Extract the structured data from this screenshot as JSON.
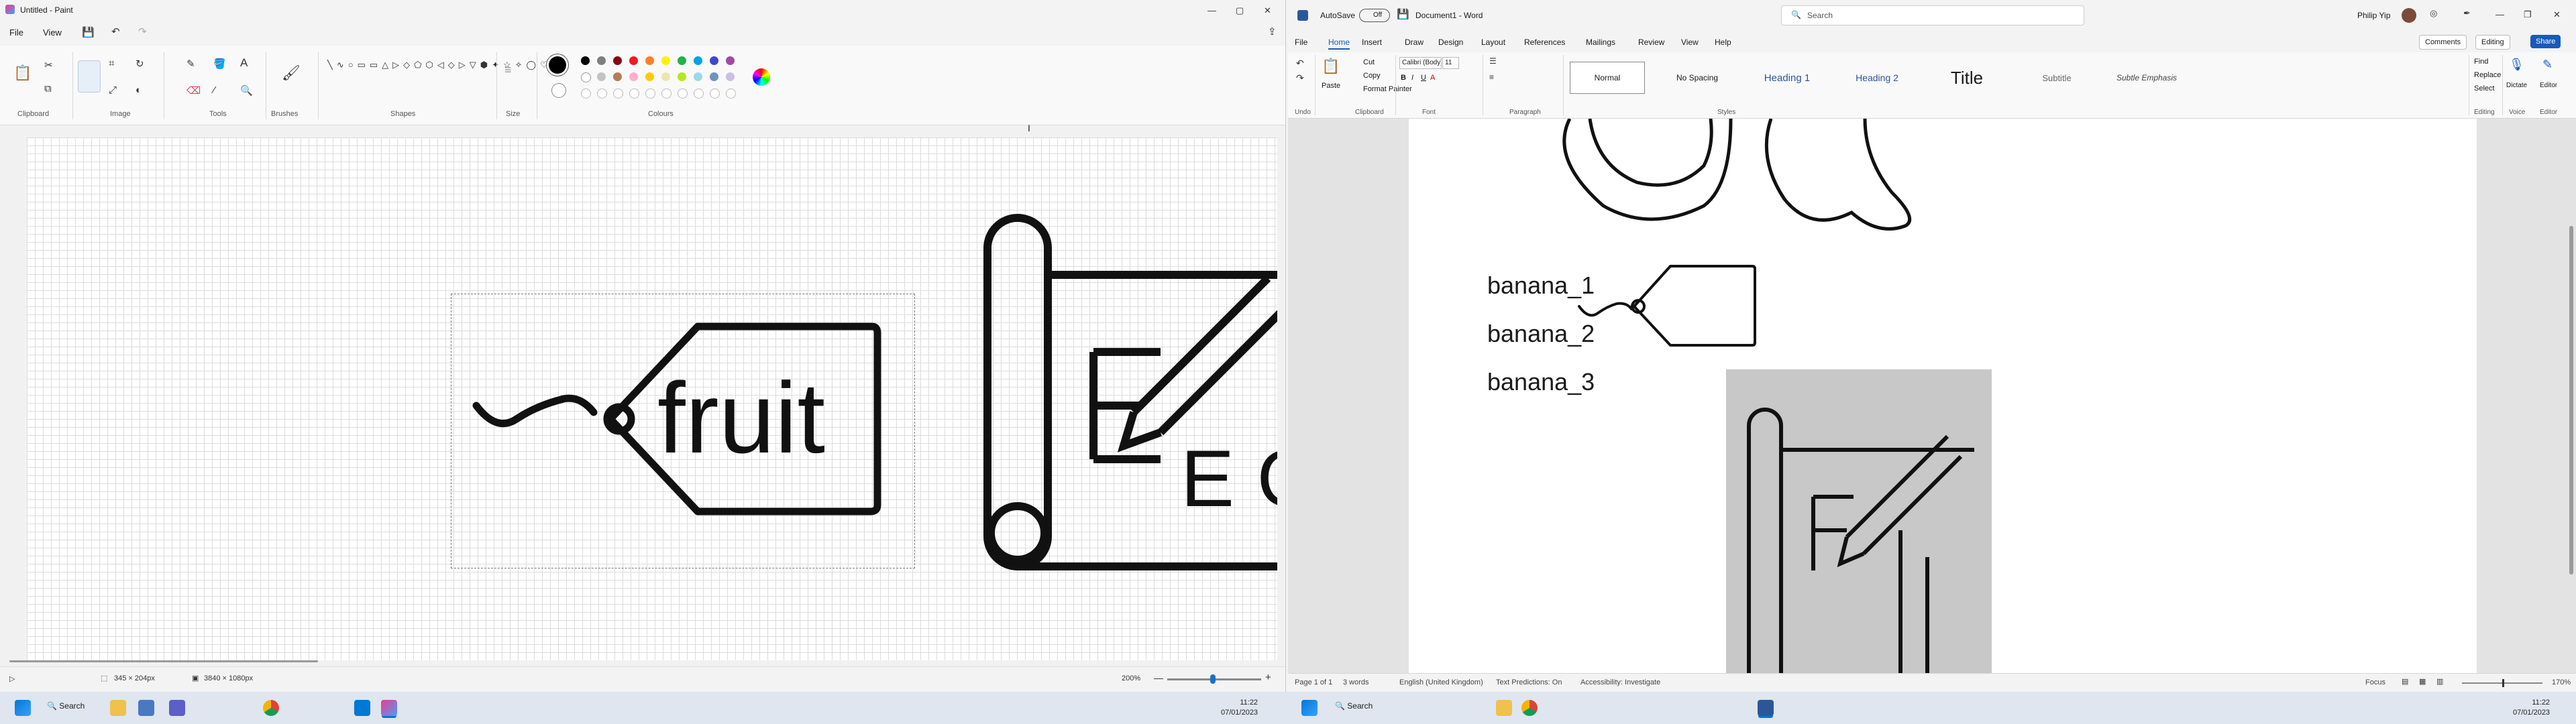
{
  "paint": {
    "title": "Untitled - Paint",
    "menu": [
      "File",
      "View"
    ],
    "groups": {
      "clipboard": "Clipboard",
      "image": "Image",
      "tools": "Tools",
      "brushes": "Brushes",
      "shapes": "Shapes",
      "size": "Size",
      "colours": "Colours"
    },
    "canvas_text": {
      "tag_word": "fruit",
      "chart_letters": "E  Gi"
    },
    "status": {
      "selection": "345 × 204px",
      "canvas_size": "3840 × 1080px",
      "zoom": "200%"
    },
    "palette": [
      "#000000",
      "#7f7f7f",
      "#880015",
      "#ed1c24",
      "#ff7f27",
      "#fff200",
      "#22b14c",
      "#00a2e8",
      "#3f48cc",
      "#a349a4",
      "#ffffff",
      "#c3c3c3",
      "#b97a57",
      "#ffaec9",
      "#ffc90e",
      "#efe4b0",
      "#b5e61d",
      "#99d9ea",
      "#7092be",
      "#c8bfe7"
    ]
  },
  "word": {
    "autosave_label": "AutoSave",
    "autosave_state": "Off",
    "doc_title": "Document1 - Word",
    "search_placeholder": "Search",
    "user": "Philip Yip",
    "tabs": [
      "File",
      "Home",
      "Insert",
      "Draw",
      "Design",
      "Layout",
      "References",
      "Mailings",
      "Review",
      "View",
      "Help"
    ],
    "comments": "Comments",
    "editing_mode": "Editing",
    "share": "Share",
    "clipboard": {
      "paste": "Paste",
      "cut": "Cut",
      "copy": "Copy",
      "format_painter": "Format Painter"
    },
    "font_name": "Calibri (Body)",
    "font_size": "11",
    "styles": [
      "Normal",
      "No Spacing",
      "Heading 1",
      "Heading 2",
      "Title",
      "Subtitle",
      "Subtle Emphasis"
    ],
    "editing": {
      "find": "Find",
      "replace": "Replace",
      "select": "Select"
    },
    "voice": {
      "dictate": "Dictate"
    },
    "editor": "Editor",
    "groups": {
      "undo": "Undo",
      "clipboard": "Clipboard",
      "font": "Font",
      "paragraph": "Paragraph",
      "styles": "Styles",
      "editing": "Editing",
      "voice": "Voice",
      "editor": "Editor"
    },
    "doc_lines": [
      "banana_1",
      "banana_2",
      "banana_3"
    ],
    "status": {
      "page": "Page 1 of 1",
      "words": "3 words",
      "language": "English (United Kingdom)",
      "predictions": "Text Predictions: On",
      "accessibility": "Accessibility: Investigate",
      "focus": "Focus",
      "zoom": "170%"
    }
  },
  "taskbar": {
    "search_left": "Search",
    "search_right": "Search",
    "time": "11:22",
    "date": "07/01/2023"
  }
}
